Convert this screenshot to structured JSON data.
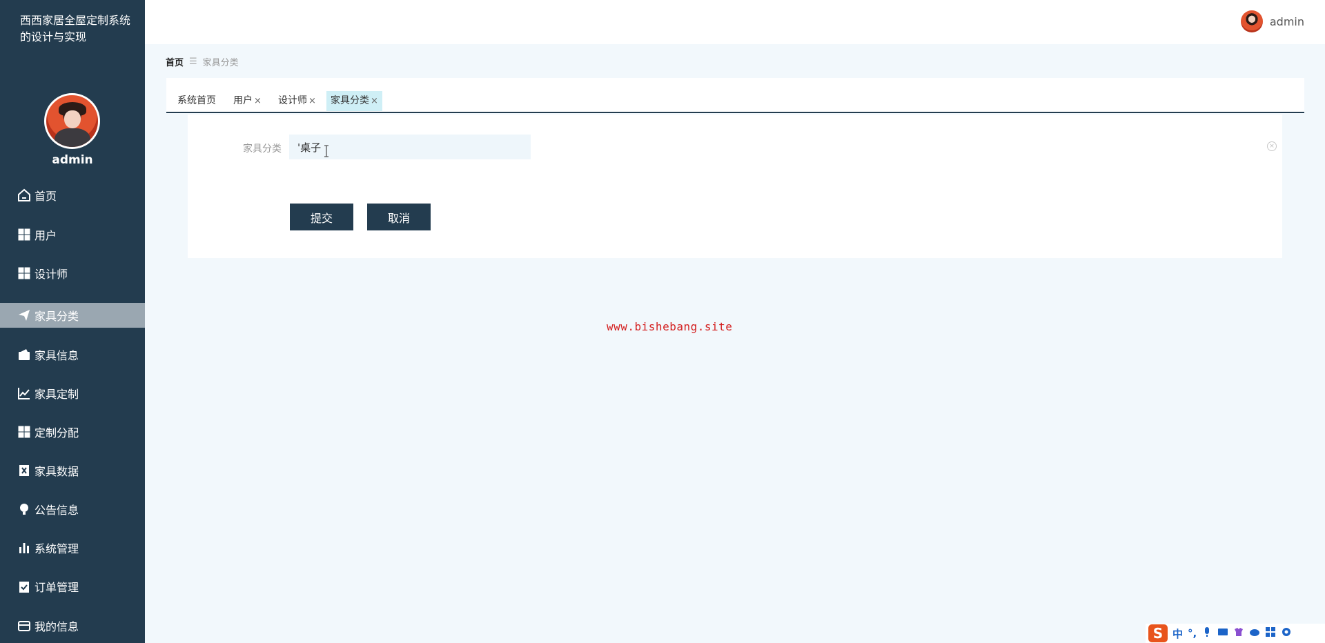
{
  "app": {
    "title": "西西家居全屋定制系统的设计与实现"
  },
  "sidebar": {
    "username": "admin",
    "items": [
      {
        "label": "首页",
        "icon": "home-icon"
      },
      {
        "label": "用户",
        "icon": "grid-icon"
      },
      {
        "label": "设计师",
        "icon": "grid-icon"
      },
      {
        "label": "家具分类",
        "icon": "paper-plane-icon",
        "active": true
      },
      {
        "label": "家具信息",
        "icon": "wallet-icon"
      },
      {
        "label": "家具定制",
        "icon": "line-chart-icon"
      },
      {
        "label": "定制分配",
        "icon": "grid-icon"
      },
      {
        "label": "家具数据",
        "icon": "excel-icon"
      },
      {
        "label": "公告信息",
        "icon": "bulb-icon"
      },
      {
        "label": "系统管理",
        "icon": "bar-chart-icon"
      },
      {
        "label": "订单管理",
        "icon": "clipboard-check-icon"
      },
      {
        "label": "我的信息",
        "icon": "card-icon"
      }
    ]
  },
  "header": {
    "username": "admin"
  },
  "breadcrumb": {
    "home": "首页",
    "separator": "☰",
    "current": "家具分类"
  },
  "tabs": [
    {
      "label": "系统首页",
      "closable": false
    },
    {
      "label": "用户",
      "closable": true
    },
    {
      "label": "设计师",
      "closable": true
    },
    {
      "label": "家具分类",
      "closable": true,
      "active": true
    }
  ],
  "tab_close_glyph": "×",
  "form": {
    "field_label": "家具分类",
    "field_value": "'桌子",
    "submit_label": "提交",
    "cancel_label": "取消",
    "clear_glyph": "×"
  },
  "watermark": "www.bishebang.site",
  "ime": {
    "logo": "S",
    "mode": "中",
    "punct": "°,"
  },
  "colors": {
    "sidebar_bg": "#233c4f",
    "active_menu_bg": "#9aa7b1",
    "active_tab_bg": "#cfeff6",
    "watermark": "#d42020",
    "button_bg": "#233c4f"
  }
}
